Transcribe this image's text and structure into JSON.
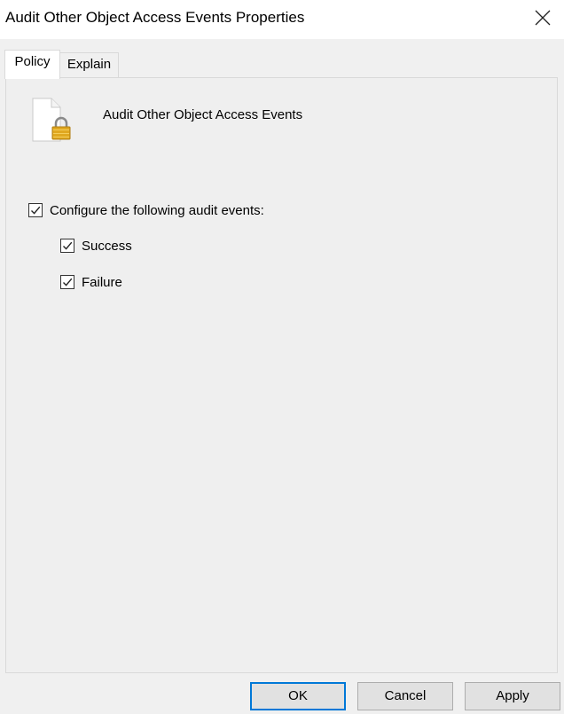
{
  "window": {
    "title": "Audit Other Object Access Events Properties",
    "close_icon": "close-icon"
  },
  "tabs": [
    {
      "label": "Policy",
      "active": true
    },
    {
      "label": "Explain",
      "active": false
    }
  ],
  "policy": {
    "icon": "policy-document-lock-icon",
    "name": "Audit Other Object Access Events",
    "configure": {
      "label": "Configure the following audit events:",
      "checked": true
    },
    "success": {
      "label": "Success",
      "checked": true
    },
    "failure": {
      "label": "Failure",
      "checked": true
    }
  },
  "buttons": {
    "ok": "OK",
    "cancel": "Cancel",
    "apply": "Apply"
  },
  "colors": {
    "accent": "#0078d7",
    "dialog_background": "#f0f0f0",
    "titlebar_background": "#ffffff",
    "lock": "#e0a820"
  }
}
